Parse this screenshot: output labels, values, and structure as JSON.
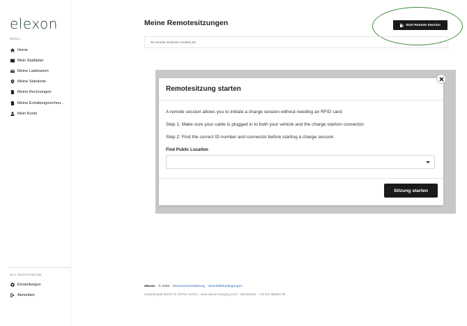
{
  "sidebar": {
    "logo": "elexon",
    "menu_label": "MENU",
    "items": [
      {
        "label": "Home",
        "icon": "home-icon"
      },
      {
        "label": "Mein Stadtplan",
        "icon": "map-icon"
      },
      {
        "label": "Meine Ladekarten",
        "icon": "card-icon"
      },
      {
        "label": "Meine Standorte",
        "icon": "location-pin-icon"
      },
      {
        "label": "Meine Rechnungen",
        "icon": "document-icon"
      },
      {
        "label": "Meine Erstattungsrechnu...",
        "icon": "document-icon"
      },
      {
        "label": "Mein Konto",
        "icon": "user-icon"
      }
    ],
    "user_name": "MAX MUSTERMANN",
    "bottom_items": [
      {
        "label": "Einstellungen",
        "icon": "gear-icon"
      },
      {
        "label": "Abmelden",
        "icon": "logout-icon"
      }
    ]
  },
  "header": {
    "title": "Meine Remotesitzungen",
    "start_button_label": "Start Remote Session",
    "empty_message": "No remote sessions created yet"
  },
  "modal": {
    "title": "Remotesitzung starten",
    "intro": "A remote session allows you to initiate a charge session without needing an RFID card.",
    "step1": "Step 1: Make sure your cable is plugged in to both your vehicle and the charge startion connector.",
    "step2": "Step 2: Find the correct ID number and connector before starting a charge session.",
    "field_label": "Find Public Location",
    "field_value": "",
    "submit_label": "Sitzung starten"
  },
  "footer": {
    "brand": "elexon",
    "copyright": "© 2025",
    "link_privacy": "Datenschutzerklärung",
    "link_terms": "Geschäftsbedingungen",
    "address": "Gewerbepark Brand 70, 52078, Aachen · www.elexon-charging.com/ · af6c9420a1 · +49 241 896363 35"
  },
  "colors": {
    "accent_dark": "#1a1a1a",
    "highlight_green": "#3d8a3a",
    "link_blue": "#2f6fbf"
  }
}
